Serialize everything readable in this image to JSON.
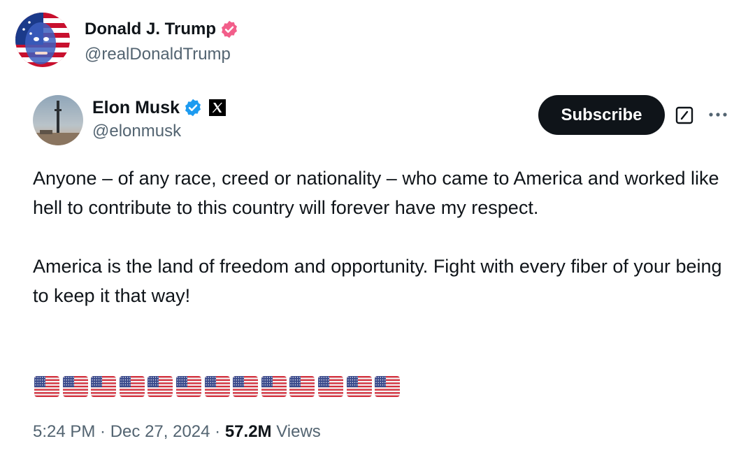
{
  "outer_author": {
    "display_name": "Donald J. Trump",
    "handle": "@realDonaldTrump",
    "badge": "verified-badge-pink",
    "badge_color": "#f25e8a"
  },
  "inner_author": {
    "display_name": "Elon Musk",
    "handle": "@elonmusk",
    "badge": "verified-badge-blue",
    "badge_color": "#1d9bf0",
    "affiliation_icon": "x-logo-icon"
  },
  "actions": {
    "subscribe_label": "Subscribe",
    "grok_icon": "grok-icon",
    "more_icon": "more-options-icon"
  },
  "tweet": {
    "paragraphs": [
      "Anyone – of any race, creed or nationality – who came to America and worked like hell to contribute to this country will forever have my respect.",
      "America is the land of freedom and opportunity. Fight with every fiber of your being to keep it that way!"
    ],
    "flags": {
      "emoji": "us-flag-emoji",
      "count": 13
    }
  },
  "meta": {
    "time": "5:24 PM",
    "separator": " · ",
    "date": "Dec 27, 2024",
    "views_count": "57.2M",
    "views_label": " Views"
  },
  "colors": {
    "text_primary": "#0f1419",
    "text_secondary": "#536471",
    "button_bg": "#0f1419"
  }
}
